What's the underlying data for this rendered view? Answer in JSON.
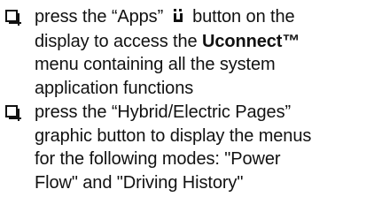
{
  "items": [
    {
      "line1_a": "press the “Apps”",
      "icon": "apps-icon",
      "line1_b": "button on the",
      "line2_a": "display to access the",
      "line2_bold": "Uconnect™",
      "line3": "menu containing all the system",
      "line4": "application functions"
    },
    {
      "line1": "press the “Hybrid/Electric Pages”",
      "line2": "graphic button to display the menus",
      "line3": "for the following modes: \"Power",
      "line4": "Flow\" and \"Driving History\""
    }
  ]
}
